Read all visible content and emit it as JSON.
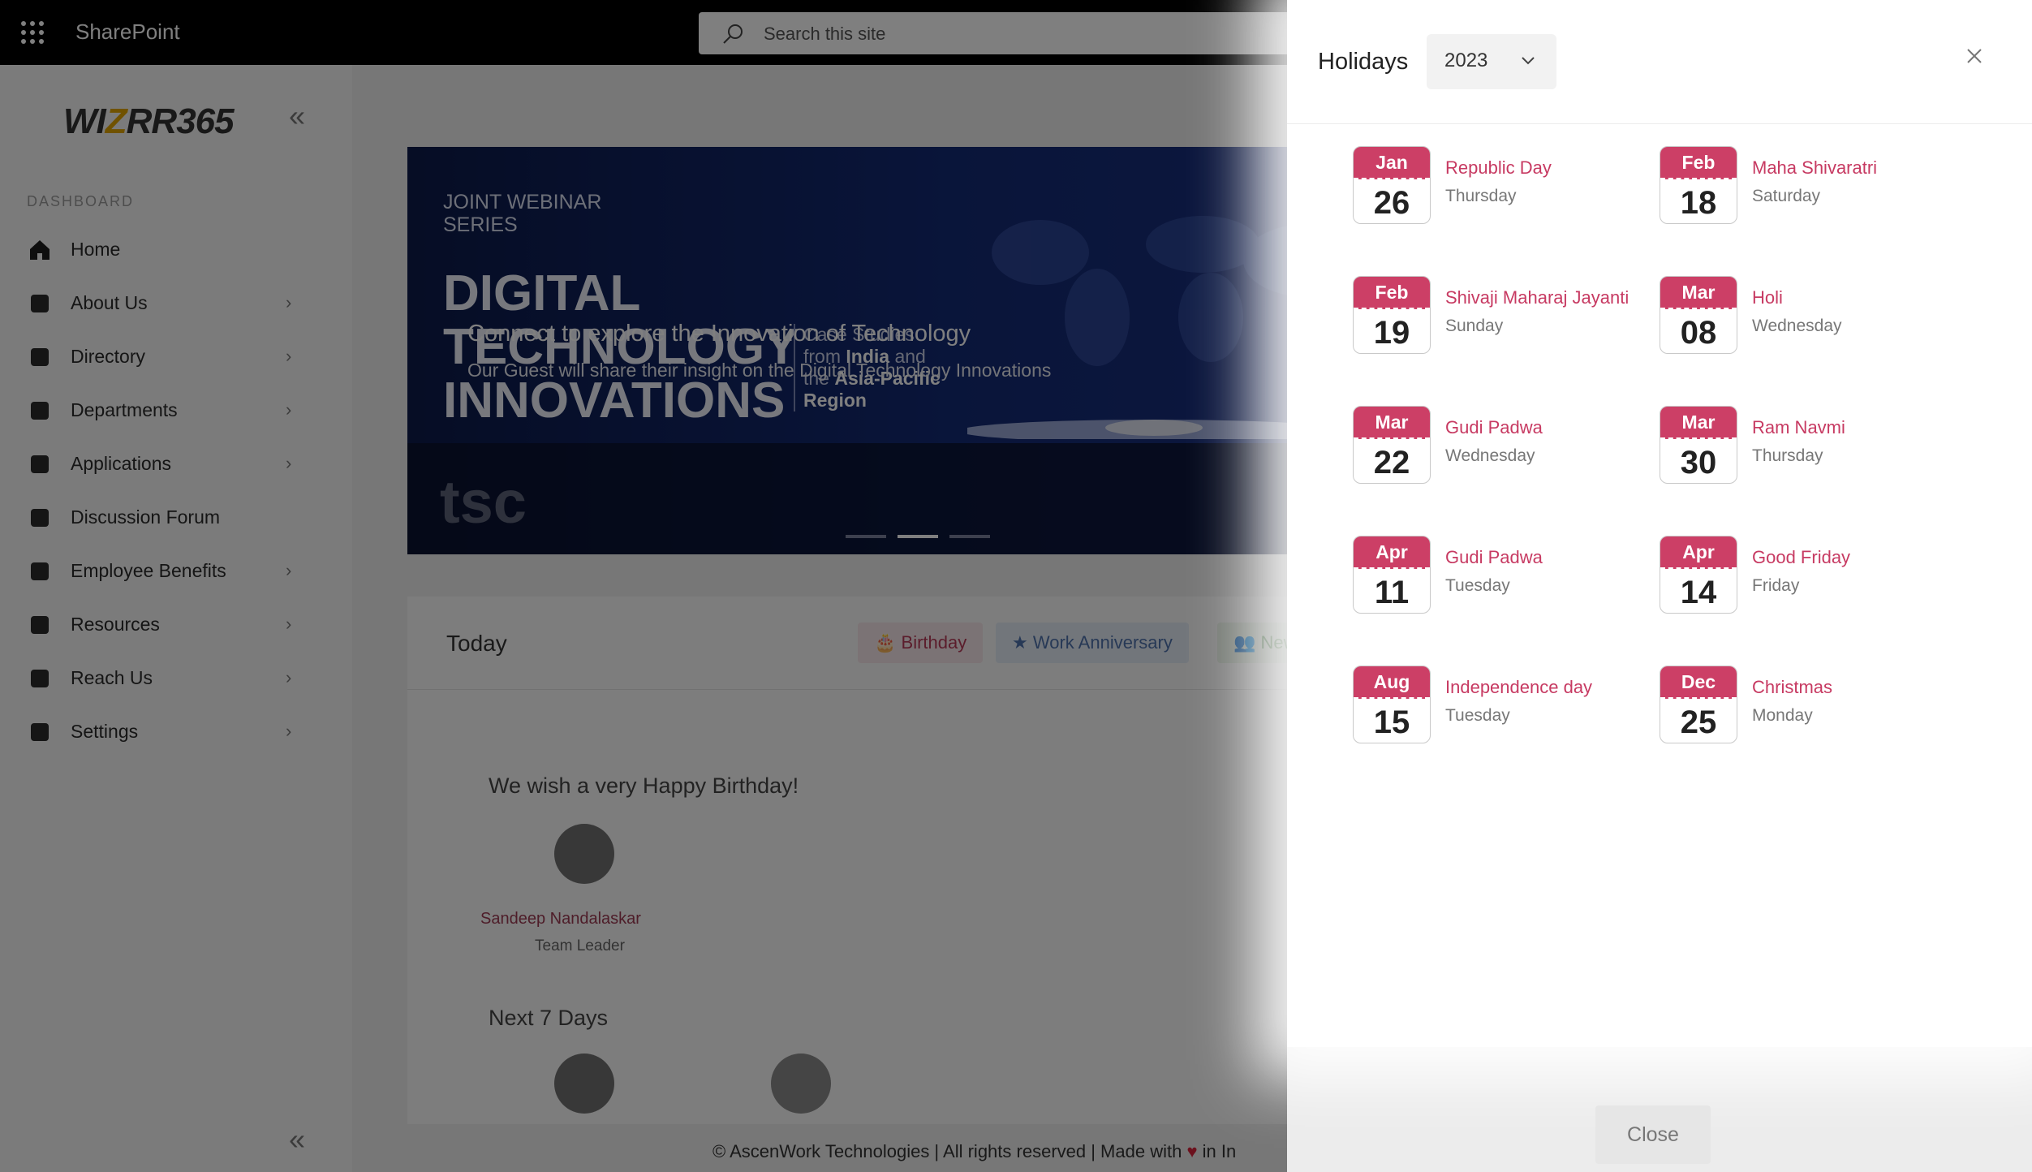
{
  "topbar": {
    "brand": "SharePoint",
    "search_placeholder": "Search this site"
  },
  "sidebar": {
    "logo_pre": "WI",
    "logo_z": "Z",
    "logo_post": "RR365",
    "section": "DASHBOARD",
    "items": [
      {
        "label": "Home",
        "icon": "home-icon",
        "chevron": false
      },
      {
        "label": "About Us",
        "icon": "about-icon",
        "chevron": true
      },
      {
        "label": "Directory",
        "icon": "directory-icon",
        "chevron": true
      },
      {
        "label": "Departments",
        "icon": "departments-icon",
        "chevron": true
      },
      {
        "label": "Applications",
        "icon": "applications-icon",
        "chevron": true
      },
      {
        "label": "Discussion Forum",
        "icon": "forum-icon",
        "chevron": false
      },
      {
        "label": "Employee Benefits",
        "icon": "benefits-icon",
        "chevron": true
      },
      {
        "label": "Resources",
        "icon": "resources-icon",
        "chevron": true
      },
      {
        "label": "Reach Us",
        "icon": "reach-icon",
        "chevron": true
      },
      {
        "label": "Settings",
        "icon": "settings-icon",
        "chevron": true
      }
    ]
  },
  "banner": {
    "series": "JOINT WEBINAR SERIES",
    "title_lines": [
      "DIGITAL",
      "TECHNOLOGY",
      "INNOVATIONS"
    ],
    "case_1": "Case Studies",
    "case_2a": "from ",
    "case_2b": "India",
    "case_2c": " and",
    "case_3a": "the ",
    "case_3b": "Asia-Pacific",
    "case_4": "Region",
    "caption": "Connect to explore the Innovation of Technology",
    "subcaption": "Our Guest will share their insight on the Digital Technology Innovations"
  },
  "today": {
    "title": "Today",
    "pills": {
      "birthday": "Birthday",
      "anniversary": "Work Anniversary",
      "new": "New"
    },
    "wish": "We wish a very Happy Birthday!",
    "person_name": "Sandeep Nandalaskar",
    "person_role": "Team Leader",
    "next7": "Next 7 Days"
  },
  "footer": "© AscenWork Technologies | All rights reserved | Made with",
  "footer_tail": "in In",
  "panel": {
    "title": "Holidays",
    "year": "2023",
    "close_label": "Close",
    "holidays": [
      {
        "month": "Jan",
        "day": "26",
        "name": "Republic Day",
        "weekday": "Thursday"
      },
      {
        "month": "Feb",
        "day": "18",
        "name": "Maha Shivaratri",
        "weekday": "Saturday"
      },
      {
        "month": "Feb",
        "day": "19",
        "name": "Shivaji Maharaj Jayanti",
        "weekday": "Sunday"
      },
      {
        "month": "Mar",
        "day": "08",
        "name": "Holi",
        "weekday": "Wednesday"
      },
      {
        "month": "Mar",
        "day": "22",
        "name": "Gudi Padwa",
        "weekday": "Wednesday"
      },
      {
        "month": "Mar",
        "day": "30",
        "name": "Ram Navmi",
        "weekday": "Thursday"
      },
      {
        "month": "Apr",
        "day": "11",
        "name": "Gudi Padwa",
        "weekday": "Tuesday"
      },
      {
        "month": "Apr",
        "day": "14",
        "name": "Good Friday",
        "weekday": "Friday"
      },
      {
        "month": "Aug",
        "day": "15",
        "name": "Independence day",
        "weekday": "Tuesday"
      },
      {
        "month": "Dec",
        "day": "25",
        "name": "Christmas",
        "weekday": "Monday"
      }
    ]
  },
  "colors": {
    "accent": "#cc3f66",
    "scrim": "#000000"
  }
}
